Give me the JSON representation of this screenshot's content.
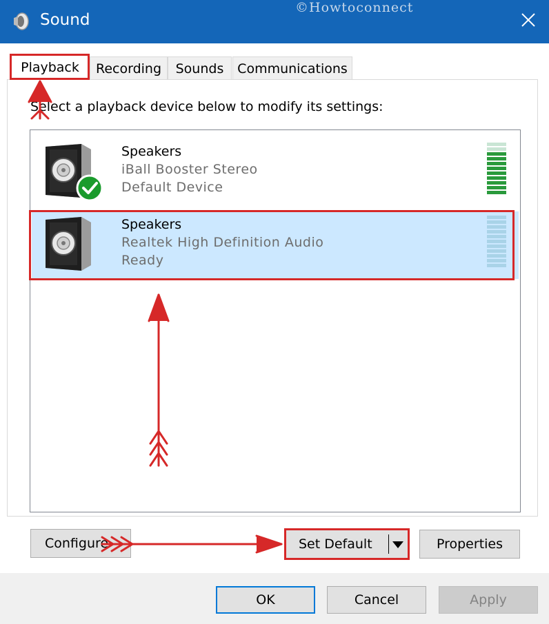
{
  "window": {
    "title": "Sound",
    "watermark": "©Howtoconnect",
    "close_icon": "close-icon"
  },
  "tabs": [
    {
      "label": "Playback",
      "active": true
    },
    {
      "label": "Recording",
      "active": false
    },
    {
      "label": "Sounds",
      "active": false
    },
    {
      "label": "Communications",
      "active": false
    }
  ],
  "instruction": "Select a playback device below to modify its settings:",
  "devices": [
    {
      "name": "Speakers",
      "description": "iBall Booster Stereo",
      "status": "Default Device",
      "icon": "speaker-icon",
      "badge": "default-check-icon",
      "selected": false
    },
    {
      "name": "Speakers",
      "description": "Realtek High Definition Audio",
      "status": "Ready",
      "icon": "speaker-icon",
      "selected": true
    }
  ],
  "buttons": {
    "configure": "Configure",
    "set_default": "Set Default",
    "properties": "Properties",
    "ok": "OK",
    "cancel": "Cancel",
    "apply": "Apply"
  },
  "colors": {
    "titlebar": "#1466b8",
    "selection": "#cce8ff",
    "annotation": "#d62828",
    "default_check": "#1a9b2c"
  }
}
